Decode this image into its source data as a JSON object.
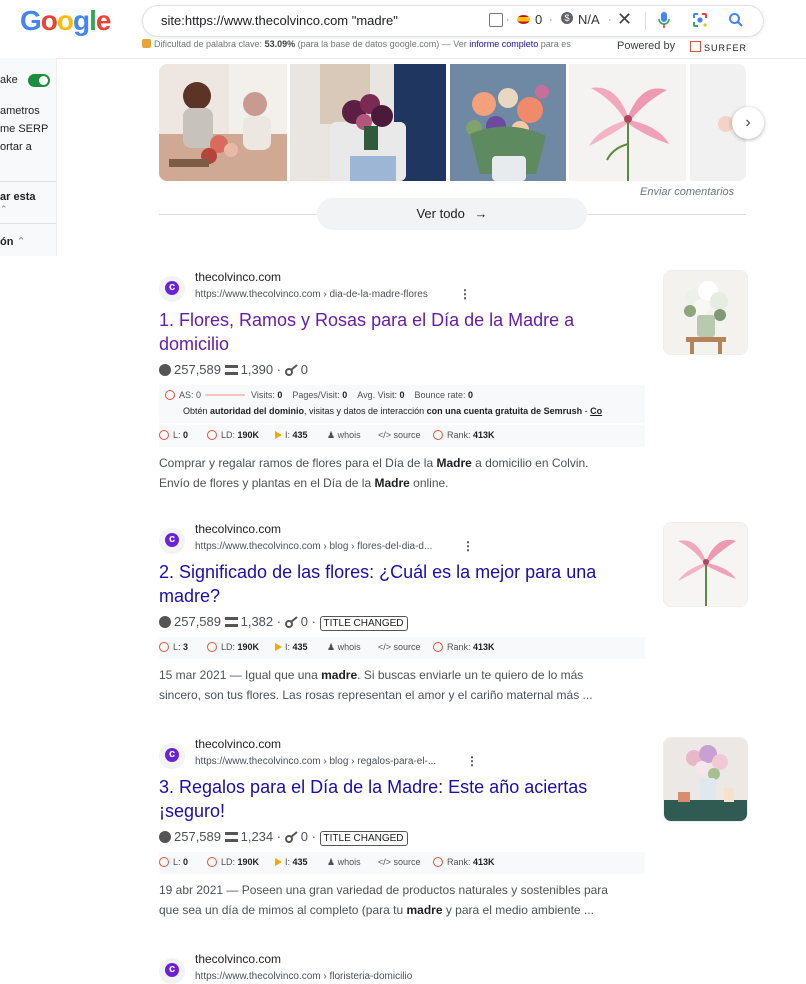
{
  "logo": {
    "text": "Google",
    "letters": [
      "G",
      "o",
      "o",
      "g",
      "l",
      "e"
    ],
    "colors": [
      "#4285F4",
      "#EA4335",
      "#FBBC05",
      "#4285F4",
      "#34A853",
      "#EA4335"
    ]
  },
  "search": {
    "query": "site:https://www.thecolvinco.com \"madre\"",
    "country_count": "0",
    "cpc": "N/A",
    "sep": "·"
  },
  "keyword_difficulty": {
    "label": "Dificultad de palabra clave:",
    "value": "53.09%",
    "note": "(para la base de datos google.com) — Ver",
    "link": "informe completo",
    "tail": "para es"
  },
  "powered_by": {
    "label": "Powered by",
    "brand": "SURFER"
  },
  "left_panel": {
    "toggle_label": "ake",
    "lines": [
      "ametros",
      "me SERP",
      "ortar a"
    ],
    "item1": "ar esta",
    "item2": "ón"
  },
  "images": {
    "feedback": "Enviar comentarios",
    "see_all": "Ver todo"
  },
  "results": [
    {
      "site": "thecolvinco.com",
      "url": "https://www.thecolvinco.com › dia-de-la-madre-flores",
      "title_line1": "1. Flores, Ramos y Rosas para el Día de la Madre a",
      "title_line2": "domicilio",
      "visited": true,
      "traffic": "257,589",
      "words": "1,390",
      "backlinks": "0",
      "badge": "",
      "semrush": {
        "as": "AS: 0",
        "visits": "0",
        "pages": "0",
        "avg": "0",
        "bounce": "0",
        "cta_pre": "Obtén ",
        "cta_b1": "autoridad del dominio",
        "cta_mid": ", visitas y datos de interacción ",
        "cta_b2": "con una cuenta gratuita de Semrush",
        "cta_end": " - ",
        "cta_link": "Co"
      },
      "moz": {
        "l": "0",
        "ld": "190K",
        "i": "435",
        "rank": "413K"
      },
      "snippet": [
        {
          "t": "Comprar y regalar ramos de flores para el Día de la "
        },
        {
          "b": "Madre"
        },
        {
          "t": " a domicilio en Colvin."
        }
      ],
      "snippet2": [
        {
          "t": "Envío de flores y plantas en el Día de la "
        },
        {
          "b": "Madre"
        },
        {
          "t": " online."
        }
      ]
    },
    {
      "site": "thecolvinco.com",
      "url": "https://www.thecolvinco.com › blog › flores-del-dia-d...",
      "title_line1": "2. Significado de las flores: ¿Cuál es la mejor para una",
      "title_line2": "madre?",
      "visited": false,
      "traffic": "257,589",
      "words": "1,382",
      "backlinks": "0",
      "badge": "TITLE CHANGED",
      "moz": {
        "l": "3",
        "ld": "190K",
        "i": "435",
        "rank": "413K"
      },
      "snippet": [
        {
          "t": "15 mar 2021 — Igual que una "
        },
        {
          "b": "madre"
        },
        {
          "t": ". Si buscas enviarle un te quiero de lo más"
        }
      ],
      "snippet2": [
        {
          "t": "sincero, son tus flores. Las rosas representan el amor y el cariño maternal más ..."
        }
      ]
    },
    {
      "site": "thecolvinco.com",
      "url": "https://www.thecolvinco.com › blog › regalos-para-el-...",
      "title_line1": "3. Regalos para el Día de la Madre: Este año aciertas",
      "title_line2": "¡seguro!",
      "visited": false,
      "traffic": "257,589",
      "words": "1,234",
      "backlinks": "0",
      "badge": "TITLE CHANGED",
      "moz": {
        "l": "0",
        "ld": "190K",
        "i": "435",
        "rank": "413K"
      },
      "snippet": [
        {
          "t": "19 abr 2021 — Poseen una gran variedad de productos naturales y sostenibles para"
        }
      ],
      "snippet2": [
        {
          "t": "que sea un día de mimos al completo (para tu "
        },
        {
          "b": "madre"
        },
        {
          "t": " y para el medio ambiente ..."
        }
      ]
    },
    {
      "site": "thecolvinco.com",
      "url": "https://www.thecolvinco.com › floristeria-domicilio"
    }
  ],
  "labels": {
    "visits": "Visits:",
    "pages": "Pages/Visit:",
    "avg": "Avg. Visit:",
    "bounce": "Bounce rate:",
    "l": "L:",
    "ld": "LD:",
    "i": "I:",
    "whois": "whois",
    "source": "source",
    "rank": "Rank:"
  },
  "colors": {
    "link": "#1a0dab",
    "visited": "#681da8",
    "favicon": "#6b21d6"
  }
}
